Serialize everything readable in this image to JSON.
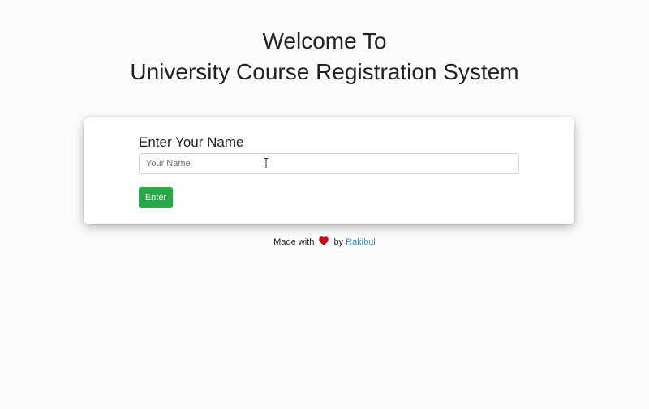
{
  "header": {
    "line1": "Welcome To",
    "line2": "University Course Registration System"
  },
  "form": {
    "label": "Enter Your Name",
    "name_input": {
      "placeholder": "Your Name",
      "value": ""
    },
    "submit_label": "Enter"
  },
  "footer": {
    "prefix": "Made with",
    "heart_icon": "heart-icon",
    "by_text": "by",
    "author": "Rakibul"
  },
  "colors": {
    "button_bg": "#28a745",
    "link": "#2f8fc9",
    "heart": "#d0021b"
  }
}
